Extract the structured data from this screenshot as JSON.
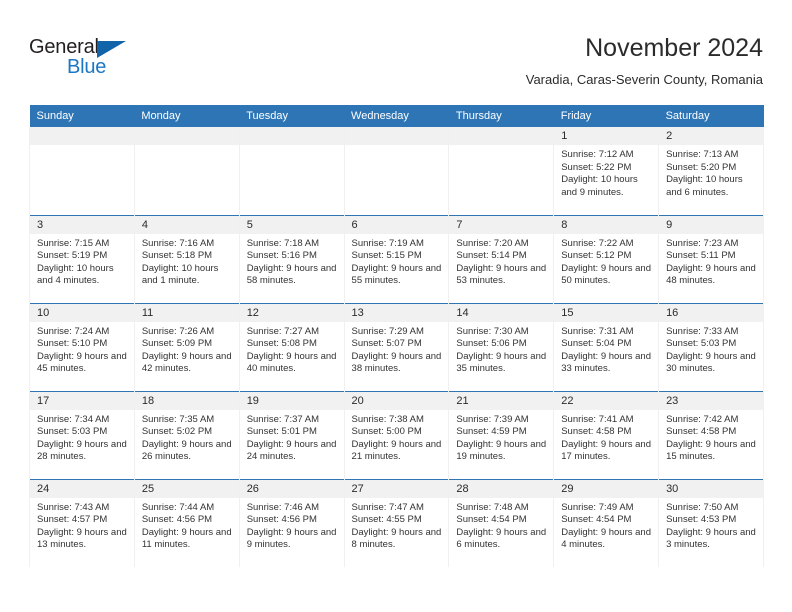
{
  "logo": {
    "word_top": "General",
    "word_bottom": "Blue",
    "accent_color": "#1b77c4",
    "triangle_color": "#1264a8",
    "triangle_icon": "triangle-flag-icon"
  },
  "header": {
    "title": "November 2024",
    "subtitle": "Varadia, Caras-Severin County, Romania"
  },
  "theme": {
    "header_blue": "#2e75b6",
    "day_strip_gray": "#f1f1f1",
    "text": "#2b2b2b"
  },
  "weekday_headers": [
    "Sunday",
    "Monday",
    "Tuesday",
    "Wednesday",
    "Thursday",
    "Friday",
    "Saturday"
  ],
  "weeks": [
    [
      {
        "day": "",
        "empty": true
      },
      {
        "day": "",
        "empty": true
      },
      {
        "day": "",
        "empty": true
      },
      {
        "day": "",
        "empty": true
      },
      {
        "day": "",
        "empty": true
      },
      {
        "day": "1",
        "sunrise": "Sunrise: 7:12 AM",
        "sunset": "Sunset: 5:22 PM",
        "daylight": "Daylight: 10 hours and 9 minutes."
      },
      {
        "day": "2",
        "sunrise": "Sunrise: 7:13 AM",
        "sunset": "Sunset: 5:20 PM",
        "daylight": "Daylight: 10 hours and 6 minutes."
      }
    ],
    [
      {
        "day": "3",
        "sunrise": "Sunrise: 7:15 AM",
        "sunset": "Sunset: 5:19 PM",
        "daylight": "Daylight: 10 hours and 4 minutes."
      },
      {
        "day": "4",
        "sunrise": "Sunrise: 7:16 AM",
        "sunset": "Sunset: 5:18 PM",
        "daylight": "Daylight: 10 hours and 1 minute."
      },
      {
        "day": "5",
        "sunrise": "Sunrise: 7:18 AM",
        "sunset": "Sunset: 5:16 PM",
        "daylight": "Daylight: 9 hours and 58 minutes."
      },
      {
        "day": "6",
        "sunrise": "Sunrise: 7:19 AM",
        "sunset": "Sunset: 5:15 PM",
        "daylight": "Daylight: 9 hours and 55 minutes."
      },
      {
        "day": "7",
        "sunrise": "Sunrise: 7:20 AM",
        "sunset": "Sunset: 5:14 PM",
        "daylight": "Daylight: 9 hours and 53 minutes."
      },
      {
        "day": "8",
        "sunrise": "Sunrise: 7:22 AM",
        "sunset": "Sunset: 5:12 PM",
        "daylight": "Daylight: 9 hours and 50 minutes."
      },
      {
        "day": "9",
        "sunrise": "Sunrise: 7:23 AM",
        "sunset": "Sunset: 5:11 PM",
        "daylight": "Daylight: 9 hours and 48 minutes."
      }
    ],
    [
      {
        "day": "10",
        "sunrise": "Sunrise: 7:24 AM",
        "sunset": "Sunset: 5:10 PM",
        "daylight": "Daylight: 9 hours and 45 minutes."
      },
      {
        "day": "11",
        "sunrise": "Sunrise: 7:26 AM",
        "sunset": "Sunset: 5:09 PM",
        "daylight": "Daylight: 9 hours and 42 minutes."
      },
      {
        "day": "12",
        "sunrise": "Sunrise: 7:27 AM",
        "sunset": "Sunset: 5:08 PM",
        "daylight": "Daylight: 9 hours and 40 minutes."
      },
      {
        "day": "13",
        "sunrise": "Sunrise: 7:29 AM",
        "sunset": "Sunset: 5:07 PM",
        "daylight": "Daylight: 9 hours and 38 minutes."
      },
      {
        "day": "14",
        "sunrise": "Sunrise: 7:30 AM",
        "sunset": "Sunset: 5:06 PM",
        "daylight": "Daylight: 9 hours and 35 minutes."
      },
      {
        "day": "15",
        "sunrise": "Sunrise: 7:31 AM",
        "sunset": "Sunset: 5:04 PM",
        "daylight": "Daylight: 9 hours and 33 minutes."
      },
      {
        "day": "16",
        "sunrise": "Sunrise: 7:33 AM",
        "sunset": "Sunset: 5:03 PM",
        "daylight": "Daylight: 9 hours and 30 minutes."
      }
    ],
    [
      {
        "day": "17",
        "sunrise": "Sunrise: 7:34 AM",
        "sunset": "Sunset: 5:03 PM",
        "daylight": "Daylight: 9 hours and 28 minutes."
      },
      {
        "day": "18",
        "sunrise": "Sunrise: 7:35 AM",
        "sunset": "Sunset: 5:02 PM",
        "daylight": "Daylight: 9 hours and 26 minutes."
      },
      {
        "day": "19",
        "sunrise": "Sunrise: 7:37 AM",
        "sunset": "Sunset: 5:01 PM",
        "daylight": "Daylight: 9 hours and 24 minutes."
      },
      {
        "day": "20",
        "sunrise": "Sunrise: 7:38 AM",
        "sunset": "Sunset: 5:00 PM",
        "daylight": "Daylight: 9 hours and 21 minutes."
      },
      {
        "day": "21",
        "sunrise": "Sunrise: 7:39 AM",
        "sunset": "Sunset: 4:59 PM",
        "daylight": "Daylight: 9 hours and 19 minutes."
      },
      {
        "day": "22",
        "sunrise": "Sunrise: 7:41 AM",
        "sunset": "Sunset: 4:58 PM",
        "daylight": "Daylight: 9 hours and 17 minutes."
      },
      {
        "day": "23",
        "sunrise": "Sunrise: 7:42 AM",
        "sunset": "Sunset: 4:58 PM",
        "daylight": "Daylight: 9 hours and 15 minutes."
      }
    ],
    [
      {
        "day": "24",
        "sunrise": "Sunrise: 7:43 AM",
        "sunset": "Sunset: 4:57 PM",
        "daylight": "Daylight: 9 hours and 13 minutes."
      },
      {
        "day": "25",
        "sunrise": "Sunrise: 7:44 AM",
        "sunset": "Sunset: 4:56 PM",
        "daylight": "Daylight: 9 hours and 11 minutes."
      },
      {
        "day": "26",
        "sunrise": "Sunrise: 7:46 AM",
        "sunset": "Sunset: 4:56 PM",
        "daylight": "Daylight: 9 hours and 9 minutes."
      },
      {
        "day": "27",
        "sunrise": "Sunrise: 7:47 AM",
        "sunset": "Sunset: 4:55 PM",
        "daylight": "Daylight: 9 hours and 8 minutes."
      },
      {
        "day": "28",
        "sunrise": "Sunrise: 7:48 AM",
        "sunset": "Sunset: 4:54 PM",
        "daylight": "Daylight: 9 hours and 6 minutes."
      },
      {
        "day": "29",
        "sunrise": "Sunrise: 7:49 AM",
        "sunset": "Sunset: 4:54 PM",
        "daylight": "Daylight: 9 hours and 4 minutes."
      },
      {
        "day": "30",
        "sunrise": "Sunrise: 7:50 AM",
        "sunset": "Sunset: 4:53 PM",
        "daylight": "Daylight: 9 hours and 3 minutes."
      }
    ]
  ]
}
